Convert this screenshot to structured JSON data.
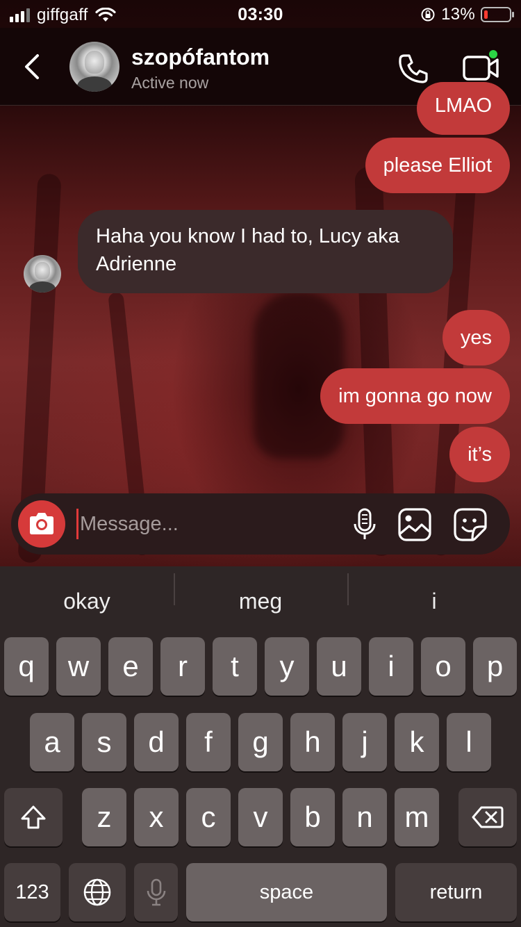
{
  "status_bar": {
    "carrier": "giffgaff",
    "time": "03:30",
    "battery_percent": "13%",
    "battery_level": 0.13
  },
  "header": {
    "username": "szopófantom",
    "activity": "Active now",
    "online_dot_color": "#2bd545"
  },
  "messages": [
    {
      "direction": "outgoing",
      "text": "LMAO"
    },
    {
      "direction": "outgoing",
      "text": "please Elliot"
    },
    {
      "direction": "incoming",
      "text": "Haha you know I had to, Lucy aka Adrienne"
    },
    {
      "direction": "outgoing",
      "text": "yes"
    },
    {
      "direction": "outgoing",
      "text": "im gonna go now"
    },
    {
      "direction": "outgoing",
      "text": "it’s"
    }
  ],
  "composer": {
    "placeholder": "Message...",
    "value": ""
  },
  "keyboard": {
    "suggestions": [
      "okay",
      "meg",
      "i"
    ],
    "row1": [
      "q",
      "w",
      "e",
      "r",
      "t",
      "y",
      "u",
      "i",
      "o",
      "p"
    ],
    "row2": [
      "a",
      "s",
      "d",
      "f",
      "g",
      "h",
      "j",
      "k",
      "l"
    ],
    "row3": [
      "z",
      "x",
      "c",
      "v",
      "b",
      "n",
      "m"
    ],
    "numbers_key": "123",
    "space_key": "space",
    "return_key": "return"
  },
  "colors": {
    "outgoing_bubble": "#c23a3a",
    "incoming_bubble": "#3b2a2b",
    "accent": "#d63a3a"
  }
}
